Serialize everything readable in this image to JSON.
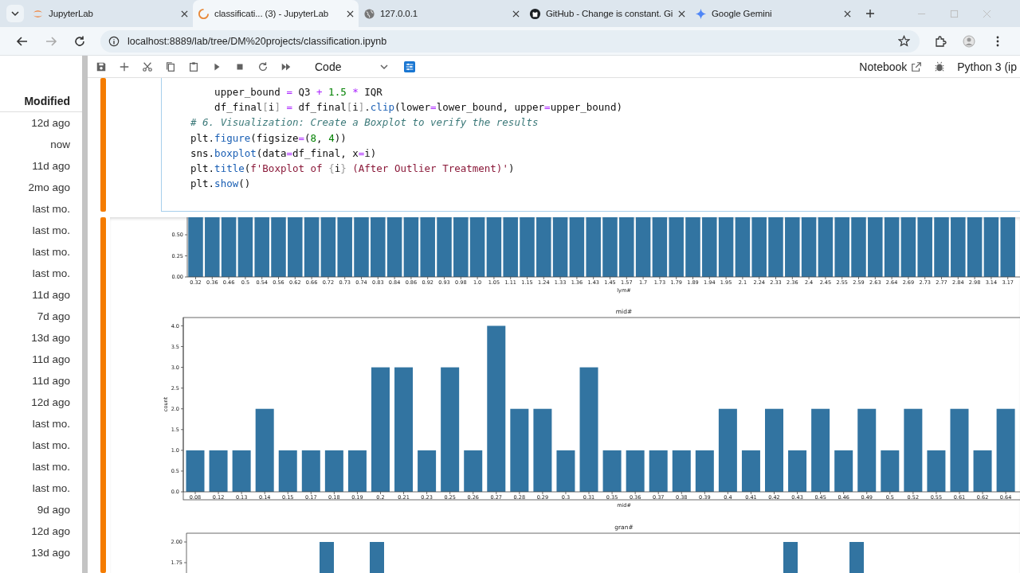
{
  "browser": {
    "tabs": [
      {
        "title": "JupyterLab",
        "selected": false
      },
      {
        "title": "classificati... (3) - JupyterLab",
        "selected": true
      },
      {
        "title": "127.0.0.1",
        "selected": false
      },
      {
        "title": "GitHub - Change is constant. Gi",
        "selected": false
      },
      {
        "title": "Google Gemini",
        "selected": false
      }
    ],
    "url": "localhost:8889/lab/tree/DM%20projects/classification.ipynb"
  },
  "file_browser": {
    "column": "Modified",
    "rows": [
      "12d ago",
      "now",
      "11d ago",
      "2mo ago",
      "last mo.",
      "last mo.",
      "last mo.",
      "last mo.",
      "11d ago",
      "7d ago",
      "13d ago",
      "11d ago",
      "11d ago",
      "12d ago",
      "last mo.",
      "last mo.",
      "last mo.",
      "last mo.",
      "9d ago",
      "12d ago",
      "13d ago"
    ]
  },
  "toolbar": {
    "cell_type": "Code",
    "open_in": "Notebook",
    "kernel": "Python 3 (ip"
  },
  "cell": {
    "code_lines": [
      [
        {
          "text": "    upper_bound ",
          "kind": "plain"
        },
        {
          "text": "=",
          "kind": "op"
        },
        {
          "text": " Q3 ",
          "kind": "plain"
        },
        {
          "text": "+",
          "kind": "op"
        },
        {
          "text": " 1.5",
          "kind": "num"
        },
        {
          "text": " *",
          "kind": "op"
        },
        {
          "text": " IQR",
          "kind": "plain"
        }
      ],
      [
        {
          "text": "    df_final",
          "kind": "plain"
        },
        {
          "text": "[",
          "kind": "bracket"
        },
        {
          "text": "i",
          "kind": "plain"
        },
        {
          "text": "]",
          "kind": "bracket"
        },
        {
          "text": " =",
          "kind": "op"
        },
        {
          "text": " df_final",
          "kind": "plain"
        },
        {
          "text": "[",
          "kind": "bracket"
        },
        {
          "text": "i",
          "kind": "plain"
        },
        {
          "text": "]",
          "kind": "bracket"
        },
        {
          "text": ".",
          "kind": "plain"
        },
        {
          "text": "clip",
          "kind": "attr"
        },
        {
          "text": "(lower",
          "kind": "plain"
        },
        {
          "text": "=",
          "kind": "op"
        },
        {
          "text": "lower_bound, upper",
          "kind": "plain"
        },
        {
          "text": "=",
          "kind": "op"
        },
        {
          "text": "upper_bound)",
          "kind": "plain"
        }
      ],
      [
        {
          "text": "# 6. Visualization: Create a Boxplot to verify the results",
          "kind": "comment"
        }
      ],
      [
        {
          "text": "plt.",
          "kind": "plain"
        },
        {
          "text": "figure",
          "kind": "attr"
        },
        {
          "text": "(figsize",
          "kind": "plain"
        },
        {
          "text": "=",
          "kind": "op"
        },
        {
          "text": "(",
          "kind": "plain"
        },
        {
          "text": "8",
          "kind": "num"
        },
        {
          "text": ", ",
          "kind": "plain"
        },
        {
          "text": "4",
          "kind": "num"
        },
        {
          "text": "))",
          "kind": "plain"
        }
      ],
      [
        {
          "text": "sns.",
          "kind": "plain"
        },
        {
          "text": "boxplot",
          "kind": "attr"
        },
        {
          "text": "(data",
          "kind": "plain"
        },
        {
          "text": "=",
          "kind": "op"
        },
        {
          "text": "df_final, x",
          "kind": "plain"
        },
        {
          "text": "=",
          "kind": "op"
        },
        {
          "text": "i)",
          "kind": "plain"
        }
      ],
      [
        {
          "text": "plt.",
          "kind": "plain"
        },
        {
          "text": "title",
          "kind": "attr"
        },
        {
          "text": "(",
          "kind": "plain"
        },
        {
          "text": "f'Boxplot of ",
          "kind": "str"
        },
        {
          "text": "{",
          "kind": "bracket"
        },
        {
          "text": "i",
          "kind": "plain"
        },
        {
          "text": "}",
          "kind": "bracket"
        },
        {
          "text": " (After Outlier Treatment)'",
          "kind": "str"
        },
        {
          "text": ")",
          "kind": "plain"
        }
      ],
      [
        {
          "text": "plt.",
          "kind": "plain"
        },
        {
          "text": "show",
          "kind": "attr"
        },
        {
          "text": "()",
          "kind": "plain"
        }
      ]
    ]
  },
  "output": {
    "charts": [
      {
        "kind": "picture",
        "xlabel": "lym#",
        "categories": [
          "0.32",
          "0.36",
          "0.46",
          "0.5",
          "0.54",
          "0.56",
          "0.62",
          "0.66",
          "0.72",
          "0.73",
          "0.74",
          "0.83",
          "0.84",
          "0.86",
          "0.92",
          "0.93",
          "0.98",
          "1.0",
          "1.05",
          "1.11",
          "1.15",
          "1.24",
          "1.33",
          "1.36",
          "1.43",
          "1.45",
          "1.57",
          "1.7",
          "1.73",
          "1.79",
          "1.89",
          "1.94",
          "1.95",
          "2.1",
          "2.24",
          "2.33",
          "2.36",
          "2.4",
          "2.45",
          "2.55",
          "2.59",
          "2.63",
          "2.64",
          "2.69",
          "2.73",
          "2.77",
          "2.84",
          "2.98",
          "3.14",
          "3.17"
        ],
        "tick_labels": [
          "0.50",
          "0.25",
          "0.00"
        ]
      },
      {
        "chart_data": {
          "type": "bar",
          "title": "mid#",
          "xlabel": "mid#",
          "ylabel": "count",
          "categories": [
            "0.08",
            "0.12",
            "0.13",
            "0.14",
            "0.15",
            "0.17",
            "0.18",
            "0.19",
            "0.2",
            "0.21",
            "0.23",
            "0.25",
            "0.26",
            "0.27",
            "0.28",
            "0.29",
            "0.3",
            "0.31",
            "0.35",
            "0.36",
            "0.37",
            "0.38",
            "0.39",
            "0.4",
            "0.41",
            "0.42",
            "0.43",
            "0.45",
            "0.46",
            "0.49",
            "0.5",
            "0.52",
            "0.55",
            "0.61",
            "0.62",
            "0.64"
          ],
          "values": [
            1,
            1,
            1,
            2,
            1,
            1,
            1,
            1,
            3,
            3,
            1,
            3,
            1,
            4,
            2,
            2,
            1,
            3,
            1,
            1,
            1,
            1,
            1,
            2,
            1,
            2,
            1,
            2,
            1,
            2,
            1,
            2,
            1,
            2,
            1,
            2
          ],
          "ylim": [
            0,
            4.2
          ],
          "yticks": [
            {
              "value": 4,
              "label": "4.0"
            },
            {
              "value": 3.5,
              "label": "3.5"
            },
            {
              "value": 3,
              "label": "3.0"
            },
            {
              "value": 2.5,
              "label": "2.5"
            },
            {
              "value": 2,
              "label": "2.0"
            },
            {
              "value": 1.5,
              "label": "1.5"
            },
            {
              "value": 1,
              "label": "1.0"
            },
            {
              "value": 0.5,
              "label": "0.5"
            },
            {
              "value": 0,
              "label": "0.0"
            }
          ]
        }
      },
      {
        "kind": "picture",
        "title": "gran#",
        "tick_labels": [
          "2.00",
          "1.75"
        ]
      }
    ]
  }
}
